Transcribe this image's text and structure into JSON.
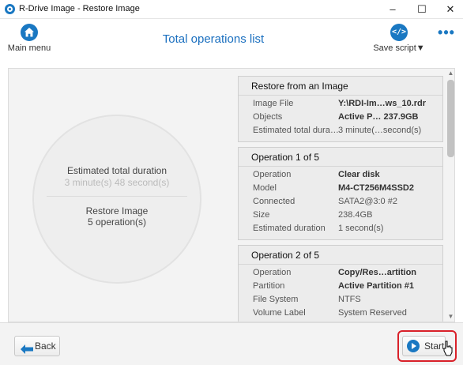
{
  "window": {
    "title": "R-Drive Image - Restore Image",
    "minimize_glyph": "–",
    "maximize_glyph": "☐",
    "close_glyph": "✕"
  },
  "toolbar": {
    "main_menu_label": "Main menu",
    "page_title": "Total operations list",
    "save_script_label": "Save script▼",
    "save_script_icon_glyph": "</>",
    "more_glyph": "•••"
  },
  "summary": {
    "duration_label": "Estimated total duration",
    "duration_value": "3 minute(s) 48 second(s)",
    "task_label": "Restore Image",
    "operations_count": "5 operation(s)"
  },
  "cards": [
    {
      "title": "Restore from an Image",
      "rows": [
        {
          "key": "Image File",
          "value": "Y:\\RDI-Im…ws_10.rdr",
          "bold": true
        },
        {
          "key": "Objects",
          "value": "Active P… 237.9GB",
          "bold": true
        },
        {
          "key": "Estimated total dura…",
          "value": "3 minute(…second(s)",
          "bold": false
        }
      ]
    },
    {
      "title": "Operation 1 of 5",
      "rows": [
        {
          "key": "Operation",
          "value": "Clear disk",
          "bold": true
        },
        {
          "key": "Model",
          "value": "M4-CT256M4SSD2",
          "bold": true
        },
        {
          "key": "Connected",
          "value": "SATA2@3:0 #2",
          "bold": false
        },
        {
          "key": "Size",
          "value": "238.4GB",
          "bold": false
        },
        {
          "key": "Estimated duration",
          "value": "1 second(s)",
          "bold": false
        }
      ]
    },
    {
      "title": "Operation 2 of 5",
      "rows": [
        {
          "key": "Operation",
          "value": "Copy/Res…artition",
          "bold": true
        },
        {
          "key": "Partition",
          "value": "Active Partition #1",
          "bold": true
        },
        {
          "key": "File System",
          "value": "NTFS",
          "bold": false
        },
        {
          "key": "Volume Label",
          "value": "System Reserved",
          "bold": false
        }
      ]
    }
  ],
  "footer": {
    "back_label": "Back",
    "start_label": "Start"
  },
  "colors": {
    "accent": "#1a78c2",
    "highlight": "#d9212a"
  }
}
